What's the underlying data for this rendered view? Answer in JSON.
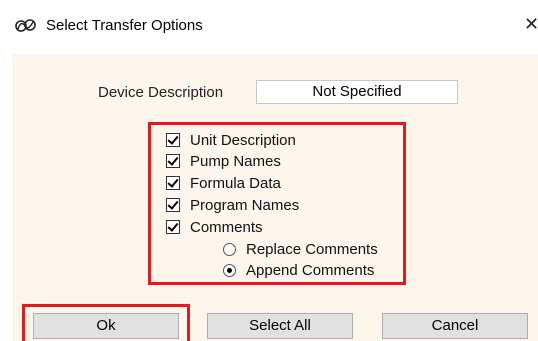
{
  "window": {
    "title": "Select Transfer Options",
    "close_glyph": "✕",
    "icon": "app-logo-icon"
  },
  "device": {
    "label": "Device Description",
    "value": "Not Specified"
  },
  "options": [
    {
      "label": "Unit Description",
      "checked": true
    },
    {
      "label": "Pump Names",
      "checked": true
    },
    {
      "label": "Formula Data",
      "checked": true
    },
    {
      "label": "Program Names",
      "checked": true
    },
    {
      "label": "Comments",
      "checked": true
    }
  ],
  "comment_mode": [
    {
      "label": "Replace Comments",
      "selected": false
    },
    {
      "label": "Append Comments",
      "selected": true
    }
  ],
  "buttons": {
    "ok": "Ok",
    "select_all": "Select All",
    "cancel": "Cancel"
  },
  "colors": {
    "dialog_background": "#fdf6ec",
    "highlight_frame": "#e31b1b",
    "button_face": "#e1e1e1"
  }
}
